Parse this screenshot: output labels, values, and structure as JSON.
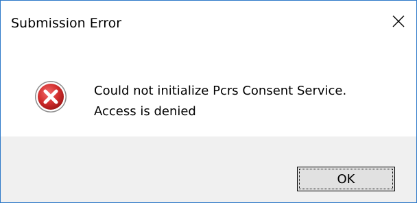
{
  "window": {
    "title": "Submission Error",
    "close_icon": "close-icon"
  },
  "message": {
    "icon": "error-icon",
    "line1": "Could not initialize Pcrs Consent Service.",
    "line2": "Access is denied"
  },
  "buttons": {
    "ok_label": "OK"
  },
  "colors": {
    "border": "#2b78c8",
    "footer_bg": "#f0f0f0",
    "error_red": "#cf2a2a"
  }
}
